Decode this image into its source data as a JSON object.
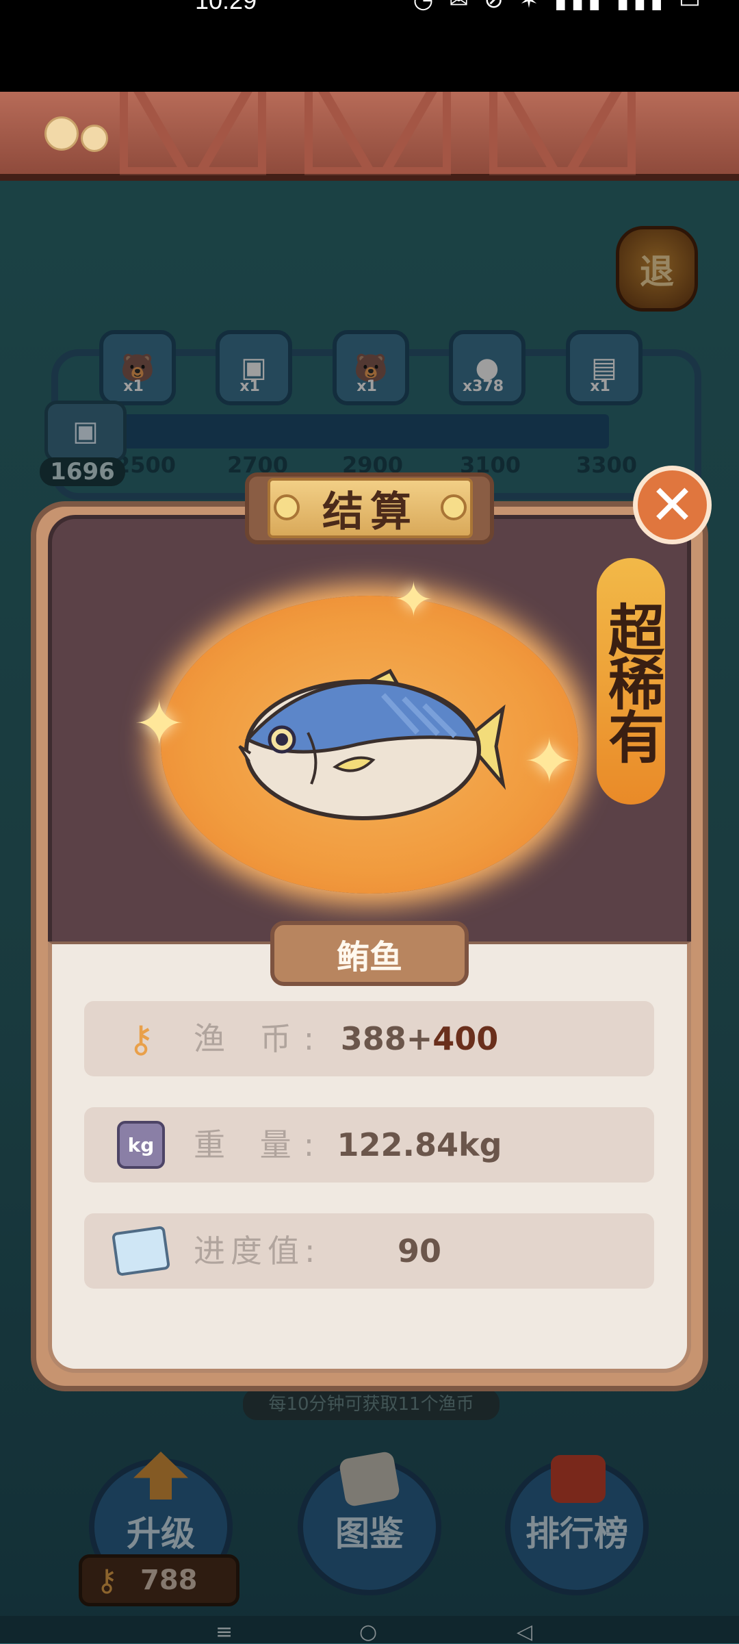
{
  "status_bar": {
    "time": "10:29",
    "icons": "◔ ✉ ⊘ ✶ ▮▮▮ ▮▮▮ ▭"
  },
  "header": {
    "exit_label": "退"
  },
  "progress": {
    "rewards": [
      {
        "icon": "🐻",
        "qty": "x1"
      },
      {
        "icon": "▣",
        "qty": "x1"
      },
      {
        "icon": "🐻",
        "qty": "x1"
      },
      {
        "icon": "●",
        "qty": "x378"
      },
      {
        "icon": "▤",
        "qty": "x1"
      }
    ],
    "milestones": [
      "2500",
      "2700",
      "2900",
      "3100",
      "3300"
    ],
    "current_value": "1696"
  },
  "result_card": {
    "title": "结算",
    "rarity": "超稀有",
    "fish_name": "鲔鱼",
    "stats": [
      {
        "icon": "coin-key-icon",
        "label": "渔  币:",
        "value": "388+",
        "bonus": "400"
      },
      {
        "icon": "weight-icon",
        "label": "重  量:",
        "value": "122.84kg",
        "bonus": ""
      },
      {
        "icon": "progress-card-icon",
        "label": "进度值:",
        "value": "90",
        "bonus": ""
      }
    ]
  },
  "tip": "每10分钟可获取11个渔币",
  "menu": {
    "upgrade": "升级",
    "catalog": "图鉴",
    "ranking": "排行榜",
    "coins": "788"
  },
  "colors": {
    "accent_orange": "#e0763e",
    "panel_brown": "#c79470",
    "gold": "#f2b948"
  }
}
